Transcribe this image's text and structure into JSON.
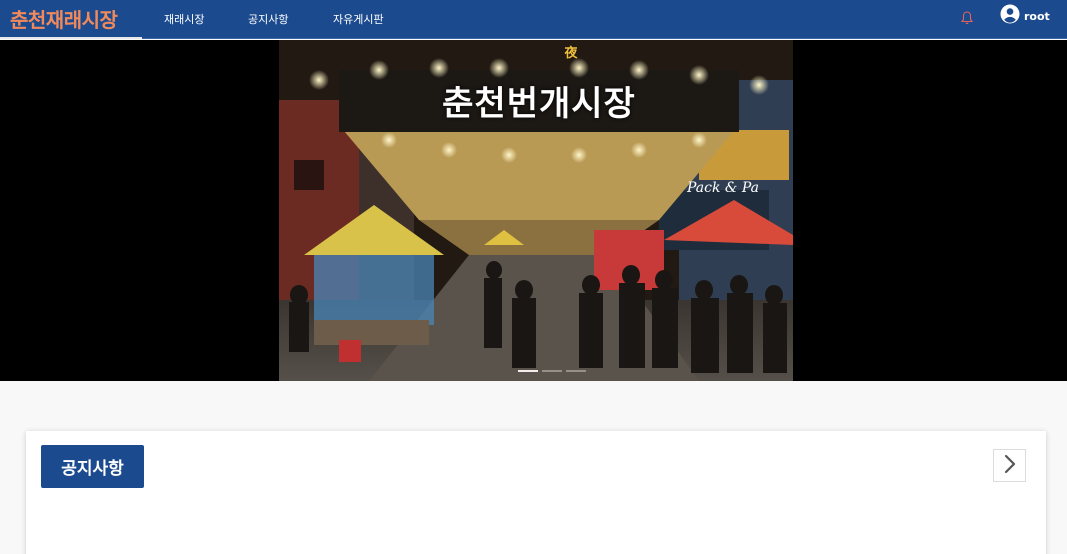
{
  "nav": {
    "brand": "춘천재래시장",
    "links": [
      "재래시장",
      "공지사항",
      "자유게시판"
    ],
    "user_name": "root",
    "icons": {
      "bell": "bell-icon",
      "user": "user-circle-icon"
    },
    "colors": {
      "primary": "#1b4a8e",
      "brand": "#f08a5d"
    }
  },
  "carousel": {
    "sign_text": "춘천번개시장",
    "sign_small": "夜",
    "storefront_text": "Pack & Pa",
    "indicator_count": 3,
    "active_index": 0
  },
  "notice": {
    "title": "공지사항",
    "next_icon": "chevron-right-icon"
  }
}
